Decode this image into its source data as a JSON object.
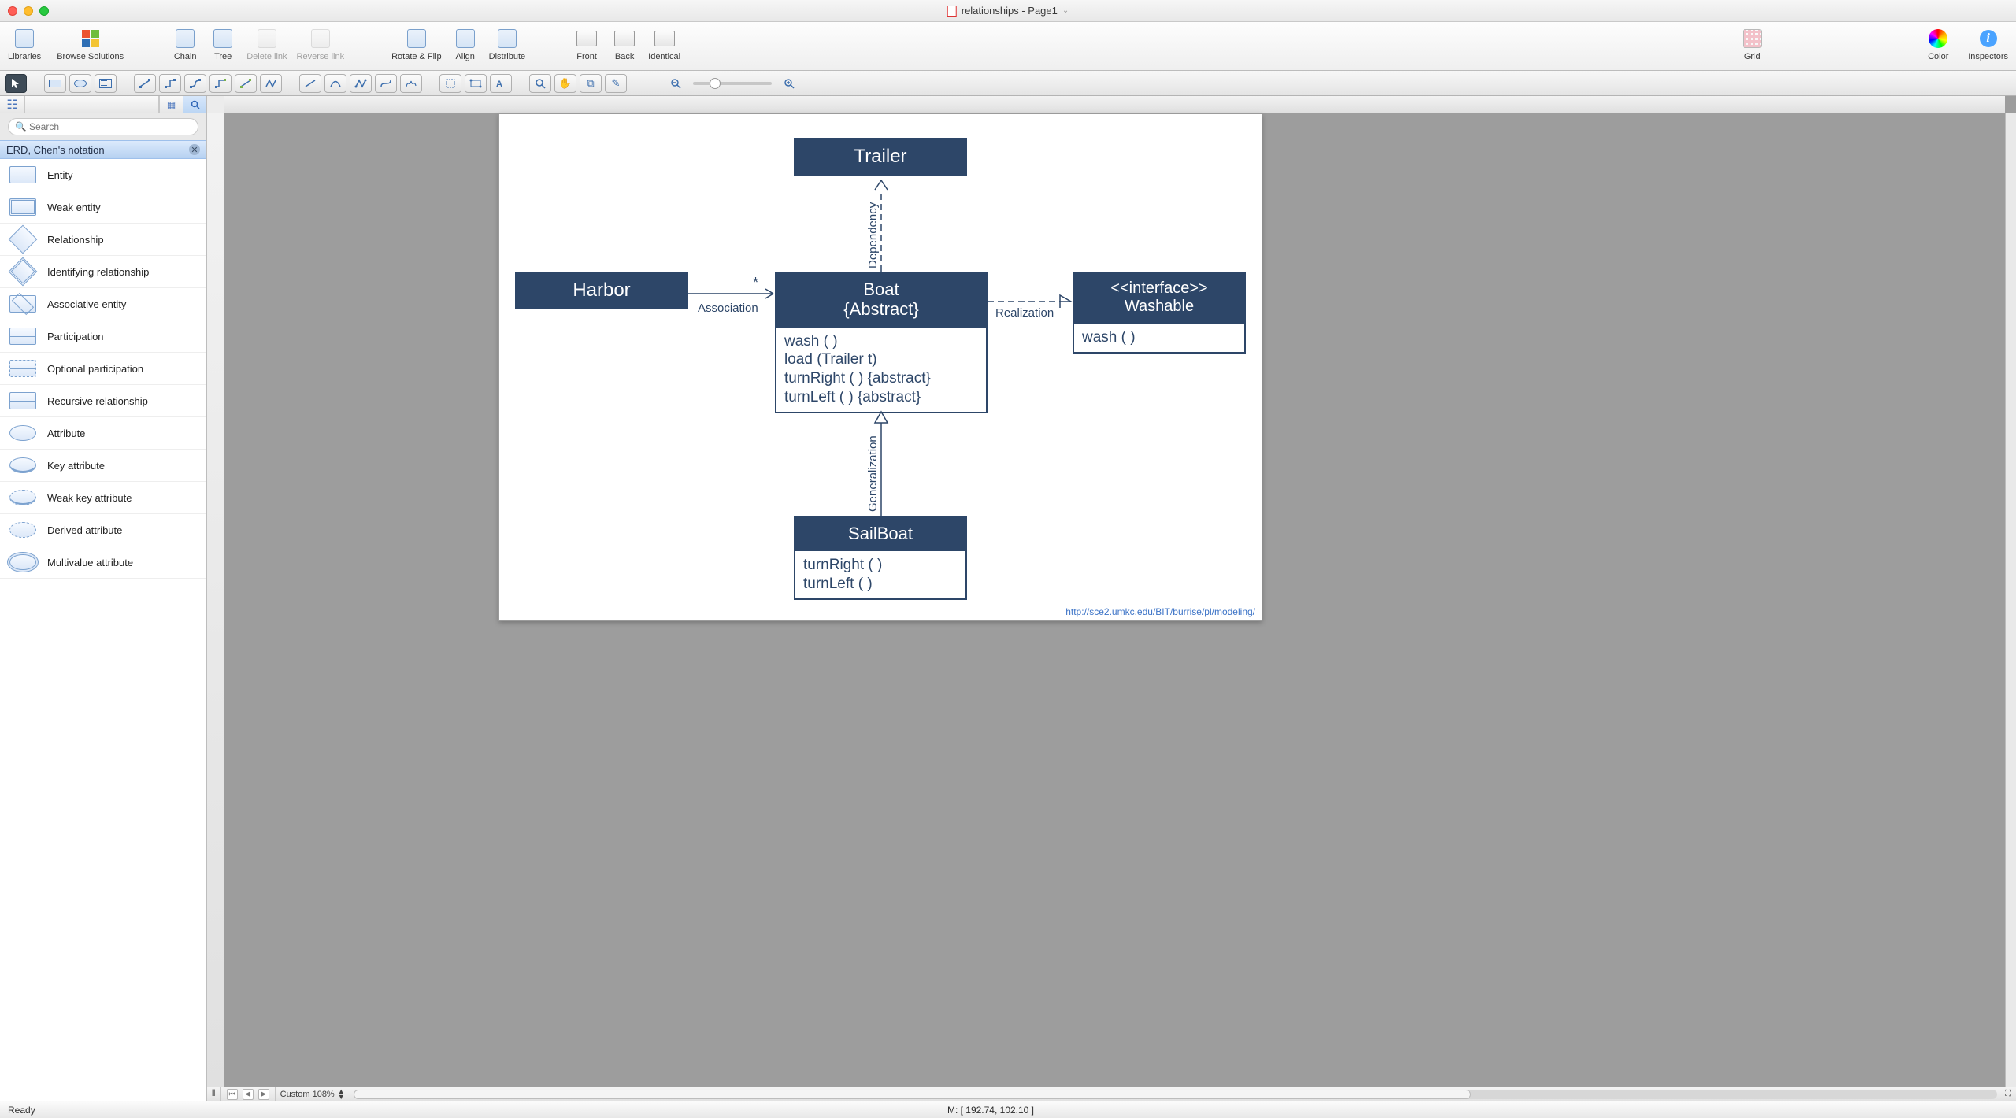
{
  "window": {
    "title": "relationships - Page1"
  },
  "toolbar1": {
    "libraries": "Libraries",
    "browse": "Browse Solutions",
    "chain": "Chain",
    "tree": "Tree",
    "delete_link": "Delete link",
    "reverse_link": "Reverse link",
    "rotate_flip": "Rotate & Flip",
    "align": "Align",
    "distribute": "Distribute",
    "front": "Front",
    "back": "Back",
    "identical": "Identical",
    "grid": "Grid",
    "color": "Color",
    "inspectors": "Inspectors"
  },
  "sidebar": {
    "search_placeholder": "Search",
    "category": "ERD, Chen's notation",
    "shapes": [
      "Entity",
      "Weak entity",
      "Relationship",
      "Identifying relationship",
      "Associative entity",
      "Participation",
      "Optional participation",
      "Recursive relationship",
      "Attribute",
      "Key attribute",
      "Weak key attribute",
      "Derived attribute",
      "Multivalue attribute"
    ]
  },
  "diagram": {
    "trailer": {
      "title": "Trailer"
    },
    "harbor": {
      "title": "Harbor"
    },
    "boat": {
      "title": "Boat\n{Abstract}",
      "ops": "wash ( )\nload (Trailer t)\nturnRight ( ) {abstract}\nturnLeft ( ) {abstract}"
    },
    "washable": {
      "title": "<<interface>>\nWashable",
      "ops": "wash ( )"
    },
    "sailboat": {
      "title": "SailBoat",
      "ops": "turnRight ( )\nturnLeft ( )"
    },
    "labels": {
      "association": "Association",
      "star": "*",
      "dependency": "Dependency",
      "realization": "Realization",
      "generalization": "Generalization"
    },
    "link": "http://sce2.umkc.edu/BIT/burrise/pl/modeling/"
  },
  "bottom": {
    "zoom": "Custom 108%"
  },
  "status": {
    "ready": "Ready",
    "mouse": "M: [ 192.74, 102.10 ]"
  }
}
